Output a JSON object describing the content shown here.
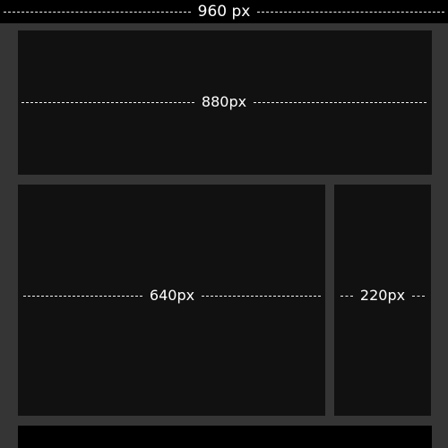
{
  "measurements": {
    "page_width_label": "960 px",
    "header_width_label": "880px",
    "main_width_label": "640px",
    "side_width_label": "220px"
  },
  "colors": {
    "background": "#000000",
    "container": "#353535",
    "box": "#111111",
    "text": "#ffffff"
  }
}
